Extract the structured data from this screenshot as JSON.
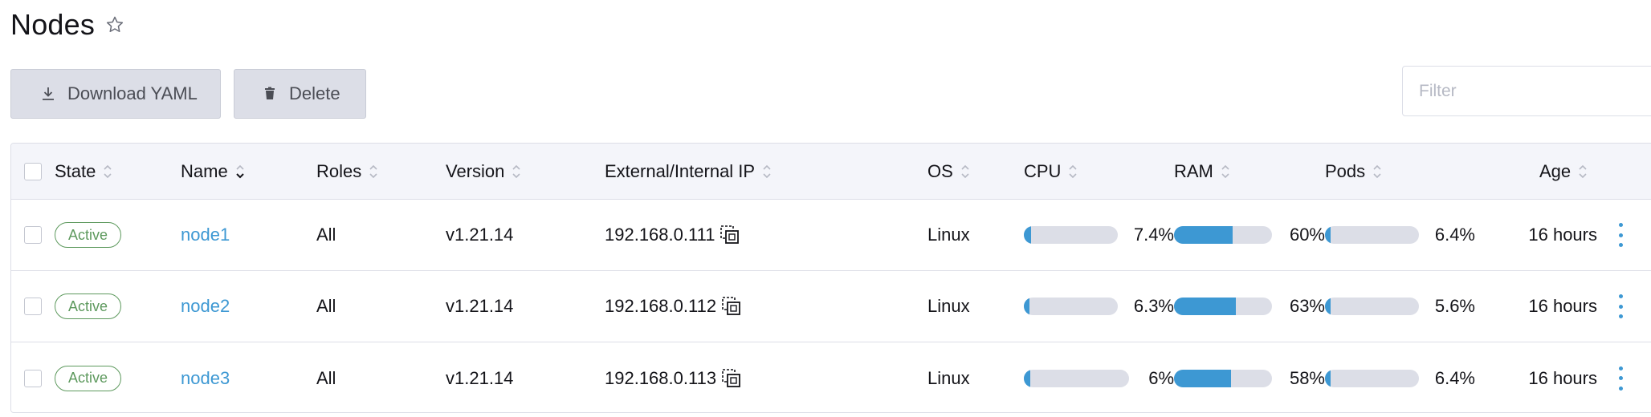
{
  "page": {
    "title": "Nodes"
  },
  "toolbar": {
    "download_label": "Download YAML",
    "delete_label": "Delete",
    "filter_placeholder": "Filter"
  },
  "columns": {
    "state": "State",
    "name": "Name",
    "roles": "Roles",
    "version": "Version",
    "ip": "External/Internal IP",
    "os": "OS",
    "cpu": "CPU",
    "ram": "RAM",
    "pods": "Pods",
    "age": "Age"
  },
  "sort": {
    "active_column": "name",
    "direction": "descending"
  },
  "colors": {
    "accent": "#3d98d3",
    "active_badge": "#5d995d",
    "bar_track": "#dcdee7",
    "button_bg": "#dcdee7"
  },
  "rows": [
    {
      "state": "Active",
      "name": "node1",
      "roles": "All",
      "version": "v1.21.14",
      "ip": "192.168.0.111",
      "os": "Linux",
      "cpu": {
        "label": "7.4%",
        "fraction": 0.074
      },
      "ram": {
        "label": "60%",
        "fraction": 0.6
      },
      "pods": {
        "label": "6.4%",
        "fraction": 0.064
      },
      "age": "16 hours"
    },
    {
      "state": "Active",
      "name": "node2",
      "roles": "All",
      "version": "v1.21.14",
      "ip": "192.168.0.112",
      "os": "Linux",
      "cpu": {
        "label": "6.3%",
        "fraction": 0.063
      },
      "ram": {
        "label": "63%",
        "fraction": 0.63
      },
      "pods": {
        "label": "5.6%",
        "fraction": 0.056
      },
      "age": "16 hours"
    },
    {
      "state": "Active",
      "name": "node3",
      "roles": "All",
      "version": "v1.21.14",
      "ip": "192.168.0.113",
      "os": "Linux",
      "cpu": {
        "label": "6%",
        "fraction": 0.06
      },
      "ram": {
        "label": "58%",
        "fraction": 0.58
      },
      "pods": {
        "label": "6.4%",
        "fraction": 0.064
      },
      "age": "16 hours"
    }
  ]
}
